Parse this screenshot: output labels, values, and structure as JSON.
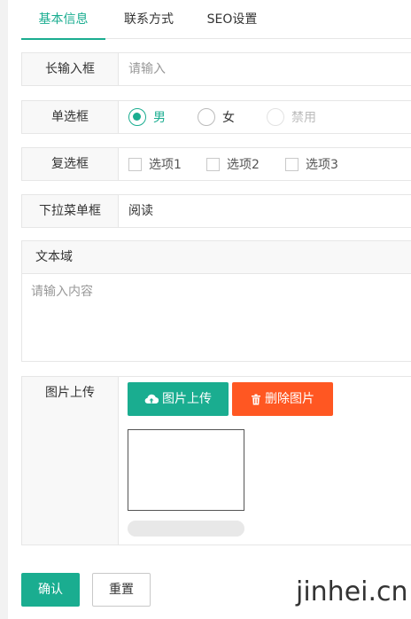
{
  "tabs": [
    {
      "label": "基本信息",
      "active": true
    },
    {
      "label": "联系方式",
      "active": false
    },
    {
      "label": "SEO设置",
      "active": false
    }
  ],
  "long_input": {
    "label": "长输入框",
    "placeholder": "请输入",
    "value": ""
  },
  "radio": {
    "label": "单选框",
    "options": [
      {
        "label": "男",
        "checked": true,
        "disabled": false
      },
      {
        "label": "女",
        "checked": false,
        "disabled": false
      },
      {
        "label": "禁用",
        "checked": false,
        "disabled": true
      }
    ]
  },
  "checkbox": {
    "label": "复选框",
    "options": [
      {
        "label": "选项1",
        "checked": false
      },
      {
        "label": "选项2",
        "checked": false
      },
      {
        "label": "选项3",
        "checked": false
      }
    ]
  },
  "select": {
    "label": "下拉菜单框",
    "value": "阅读"
  },
  "textarea": {
    "label": "文本域",
    "placeholder": "请输入内容",
    "value": ""
  },
  "upload": {
    "label": "图片上传",
    "upload_button": "图片上传",
    "delete_button": "删除图片",
    "progress": 0,
    "upload_icon": "cloud-upload-icon",
    "delete_icon": "trash-icon"
  },
  "actions": {
    "confirm": "确认",
    "reset": "重置"
  },
  "watermark": "jinhei.cn",
  "colors": {
    "accent": "#1aad90",
    "danger": "#ff5722",
    "label_bg": "#f8f8f8",
    "border": "#e6e6e6"
  }
}
